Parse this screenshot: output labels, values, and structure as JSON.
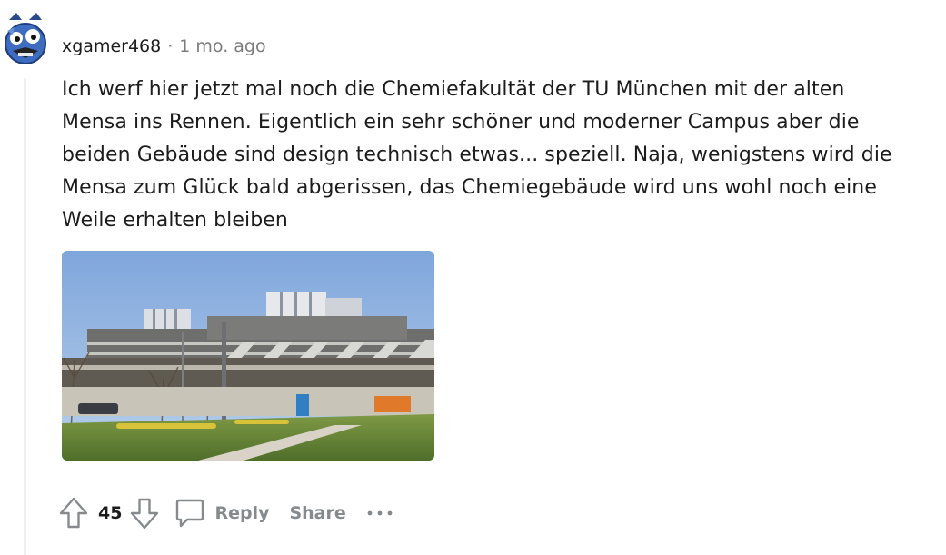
{
  "comment": {
    "username": "xgamer468",
    "separator": "·",
    "time_ago": "1 mo. ago",
    "body_lines": [
      "Ich werf hier jetzt mal noch die Chemiefakultät der TU München mit der alten",
      "Mensa ins Rennen. Eigentlich ein sehr schöner und moderner Campus aber die",
      "beiden Gebäude sind design technisch etwas... speziell. Naja, wenigstens wird die",
      "Mensa zum Glück bald abgerissen, das Chemiegebäude wird uns wohl noch eine",
      "Weile erhalten bleiben"
    ]
  },
  "actions": {
    "upvote_icon": "arrow-up-outline",
    "vote_count": "45",
    "downvote_icon": "arrow-down-outline",
    "reply_icon": "speech-bubble",
    "reply_label": "Reply",
    "share_label": "Share",
    "more_icon": "ellipsis"
  },
  "colors": {
    "text": "#1c1c1c",
    "muted": "#7c7c7c",
    "action": "#878a8c",
    "thread_line": "#edeff1"
  }
}
